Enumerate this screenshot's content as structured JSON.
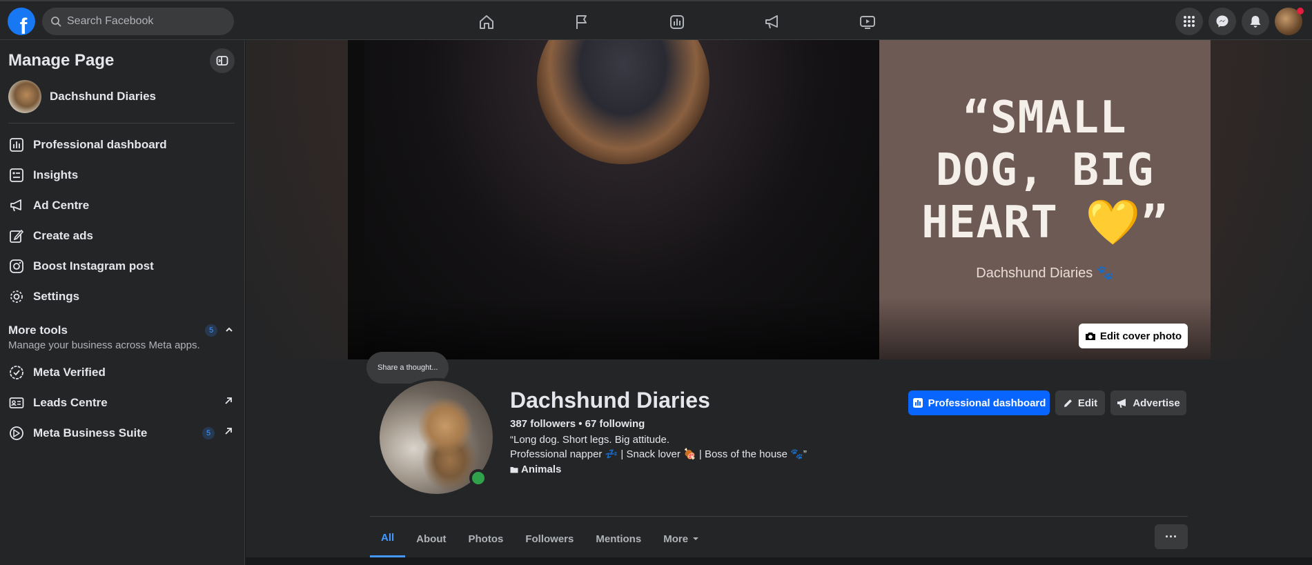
{
  "topbar": {
    "logo_letter": "f",
    "search_placeholder": "Search Facebook",
    "nav_icons": [
      "home-icon",
      "flag-icon",
      "insights-icon",
      "megaphone-icon",
      "video-icon"
    ],
    "right_icons": [
      "menu-grid-icon",
      "messenger-icon",
      "notifications-icon",
      "account-avatar"
    ]
  },
  "sidebar": {
    "title": "Manage Page",
    "page_name": "Dachshund Diaries",
    "items": [
      {
        "label": "Professional dashboard",
        "icon": "dashboard-icon"
      },
      {
        "label": "Insights",
        "icon": "insights-icon"
      },
      {
        "label": "Ad Centre",
        "icon": "megaphone-icon"
      },
      {
        "label": "Create ads",
        "icon": "pencil-icon"
      },
      {
        "label": "Boost Instagram post",
        "icon": "instagram-icon"
      },
      {
        "label": "Settings",
        "icon": "gear-icon"
      }
    ],
    "more_tools": {
      "title": "More tools",
      "subtitle": "Manage your business across Meta apps.",
      "badge": "5"
    },
    "tools": [
      {
        "label": "Meta Verified",
        "icon": "verified-icon"
      },
      {
        "label": "Leads Centre",
        "icon": "contact-card-icon"
      },
      {
        "label": "Meta Business Suite",
        "icon": "business-suite-icon",
        "badge": "5"
      }
    ]
  },
  "cover": {
    "quote": "“SMALL DOG, BIG HEART 💛”",
    "quote_line1": "“SMALL",
    "quote_line2": "DOG, BIG",
    "quote_line3": "HEART 💛”",
    "signature": "Dachshund Diaries 🐾",
    "edit_label": "Edit cover photo"
  },
  "profile": {
    "thought_placeholder": "Share a thought...",
    "name": "Dachshund Diaries",
    "stats": "387 followers • 67 following",
    "bio_line1": "“Long dog. Short legs. Big attitude.",
    "bio_line2": "Professional napper 💤 | Snack lover 🍖 | Boss of the house 🐾”",
    "category": "Animals",
    "buttons": {
      "dashboard": "Professional dashboard",
      "edit": "Edit",
      "advertise": "Advertise"
    }
  },
  "tabs": [
    {
      "label": "All",
      "active": true
    },
    {
      "label": "About",
      "active": false
    },
    {
      "label": "Photos",
      "active": false
    },
    {
      "label": "Followers",
      "active": false
    },
    {
      "label": "Mentions",
      "active": false
    }
  ],
  "tabs_more": "More",
  "tabs_dots": "···",
  "colors": {
    "accent": "#0866ff",
    "active_tab": "#4599ff",
    "online": "#31a24c",
    "surface": "#242526"
  }
}
